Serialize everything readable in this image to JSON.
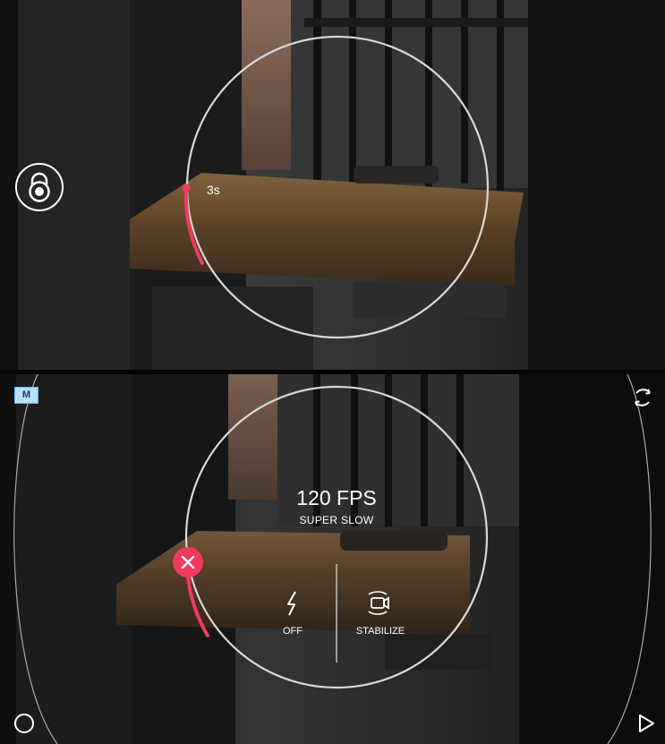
{
  "top": {
    "timer_label": "3s",
    "lock_icon": "lock-icon",
    "record_progress": 0.08
  },
  "bottom": {
    "mode_badge": "M",
    "fps_value": "120 FPS",
    "fps_sublabel": "SUPER SLOW",
    "flash": {
      "icon": "flash-icon",
      "label": "OFF"
    },
    "stabilize": {
      "icon": "stabilize-icon",
      "label": "STABILIZE"
    },
    "icons": [
      "close-icon",
      "rotate-camera-icon",
      "circle-shutter-icon",
      "play-icon"
    ],
    "record_progress": 0.06
  },
  "colors": {
    "accent": "#F03A5F",
    "ring": "#D7D7D7",
    "text": "#FFFFFF",
    "badge": "#62B6FF"
  }
}
